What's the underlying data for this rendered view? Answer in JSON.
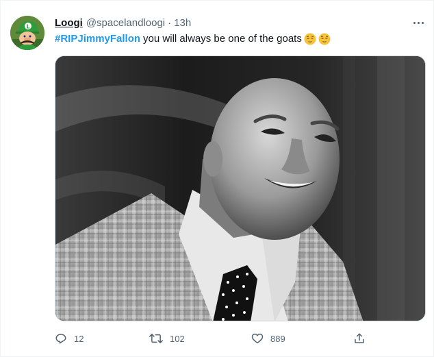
{
  "tweet": {
    "display_name": "Loogi",
    "handle": "@spacelandloogi",
    "separator": "·",
    "time": "13h",
    "hashtag": "#RIPJimmyFallon",
    "text": "you will always be one of the goats",
    "emojis": [
      "relieved-face",
      "relieved-face"
    ]
  },
  "actions": {
    "reply_count": "12",
    "retweet_count": "102",
    "like_count": "889"
  },
  "icons": {
    "more": "more-horizontal-icon",
    "reply": "reply-icon",
    "retweet": "retweet-icon",
    "like": "heart-icon",
    "share": "share-icon"
  },
  "colors": {
    "accent": "#1d9bf0",
    "secondary_text": "#536471",
    "primary_text": "#0f1419"
  }
}
